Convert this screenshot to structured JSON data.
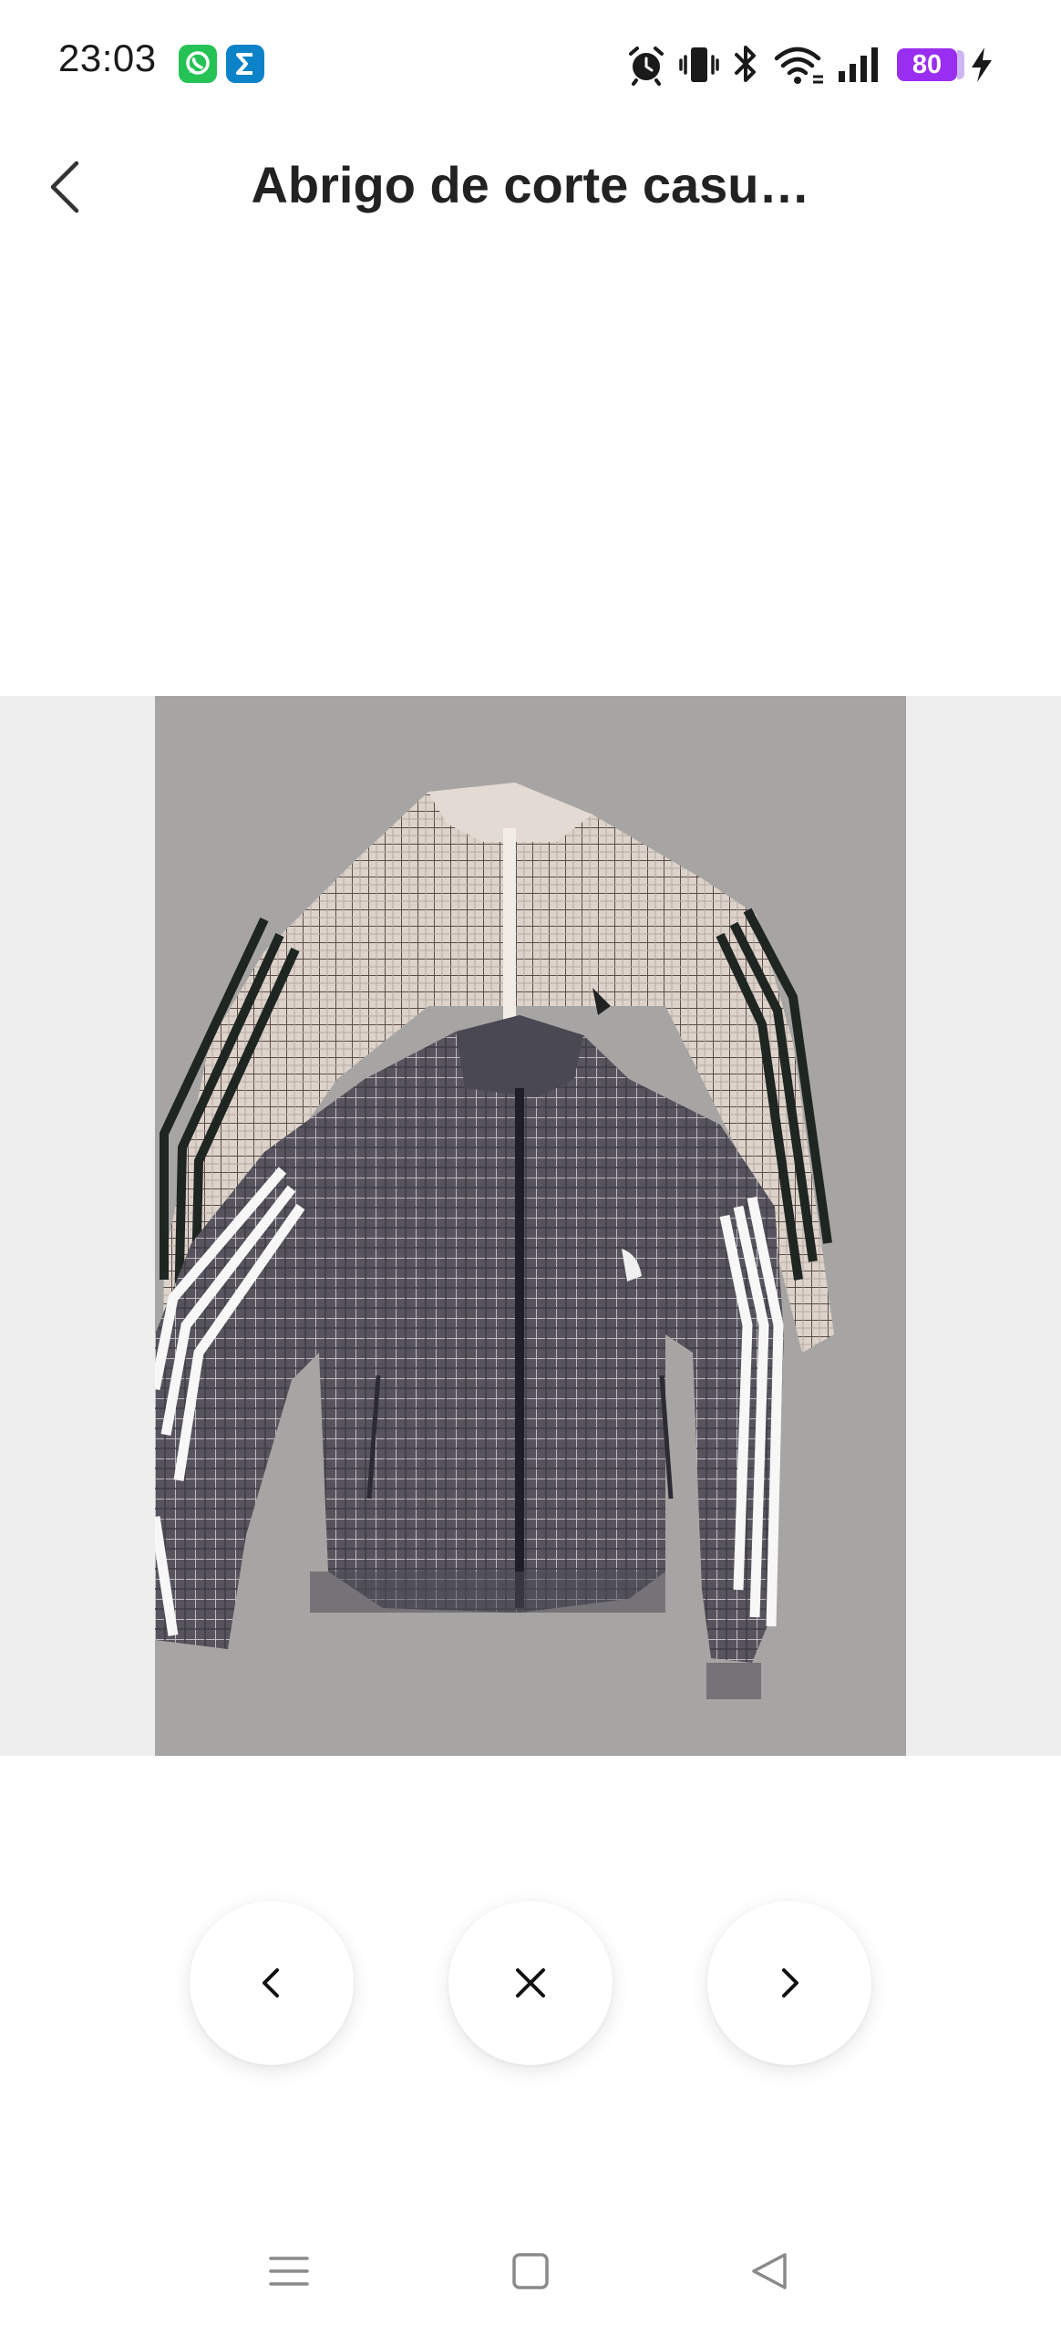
{
  "status_bar": {
    "time": "23:03",
    "battery_level": "80",
    "notification_icons": [
      "whatsapp-icon",
      "sigma-icon"
    ],
    "system_icons": [
      "alarm-icon",
      "vibrate-icon",
      "bluetooth-icon",
      "wifi-icon",
      "signal-icon",
      "battery-icon",
      "charging-icon"
    ],
    "battery_color": "#9a2ef0"
  },
  "header": {
    "title": "Abrigo de corte casu…",
    "back_icon": "chevron-left-icon"
  },
  "viewer": {
    "image_subject": "two plaid zip-up track jackets with three stripes on sleeves",
    "background_color": "#eeeeee"
  },
  "controls": {
    "prev_icon": "chevron-left-icon",
    "close_icon": "close-icon",
    "next_icon": "chevron-right-icon"
  },
  "system_nav": {
    "items": [
      "menu-icon",
      "home-icon",
      "back-triangle-icon"
    ]
  }
}
